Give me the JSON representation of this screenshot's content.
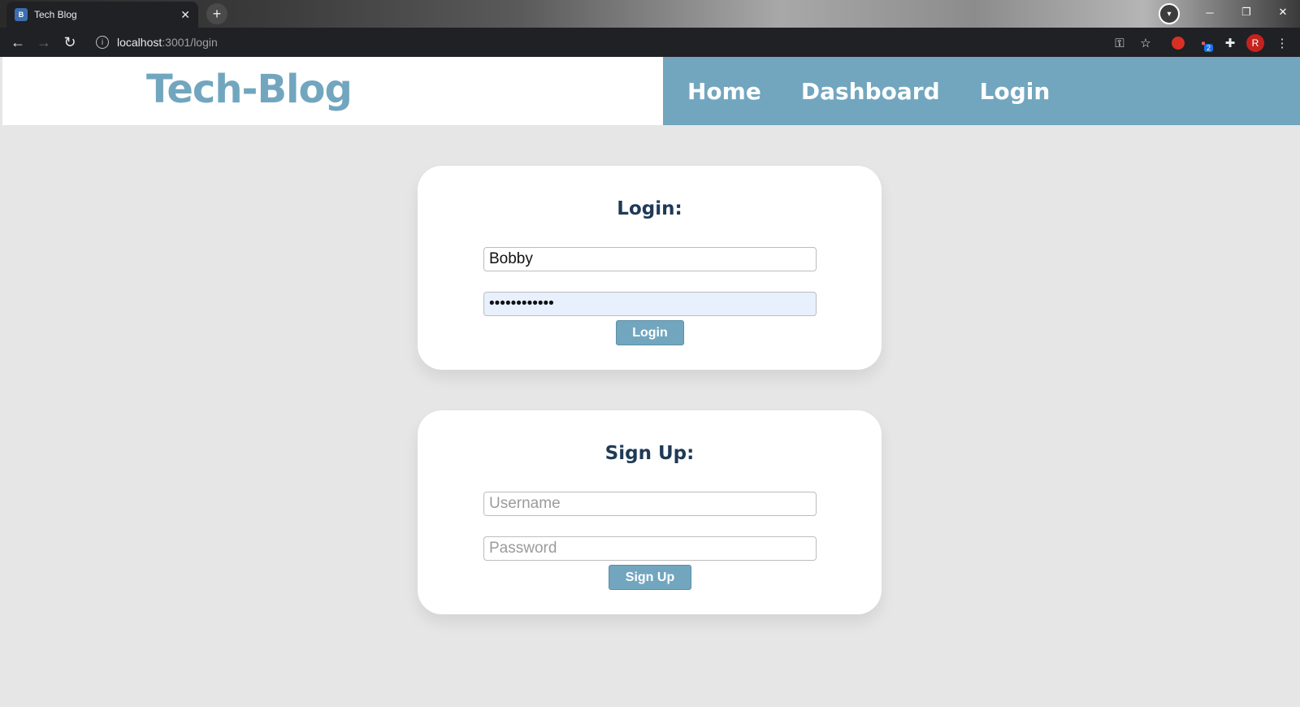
{
  "browser": {
    "tab_title": "Tech Blog",
    "url_host": "localhost",
    "url_path": ":3001/login",
    "extension_badge": "2",
    "profile_initial": "R"
  },
  "site": {
    "brand": "Tech-Blog",
    "nav": [
      "Home",
      "Dashboard",
      "Login"
    ],
    "accent_color": "#72a6bf",
    "background_color": "#e6e6e6"
  },
  "login": {
    "heading": "Login:",
    "username_value": "Bobby",
    "password_value": "••••••••••••",
    "button": "Login"
  },
  "signup": {
    "heading": "Sign Up:",
    "username_placeholder": "Username",
    "password_placeholder": "Password",
    "button": "Sign Up"
  }
}
